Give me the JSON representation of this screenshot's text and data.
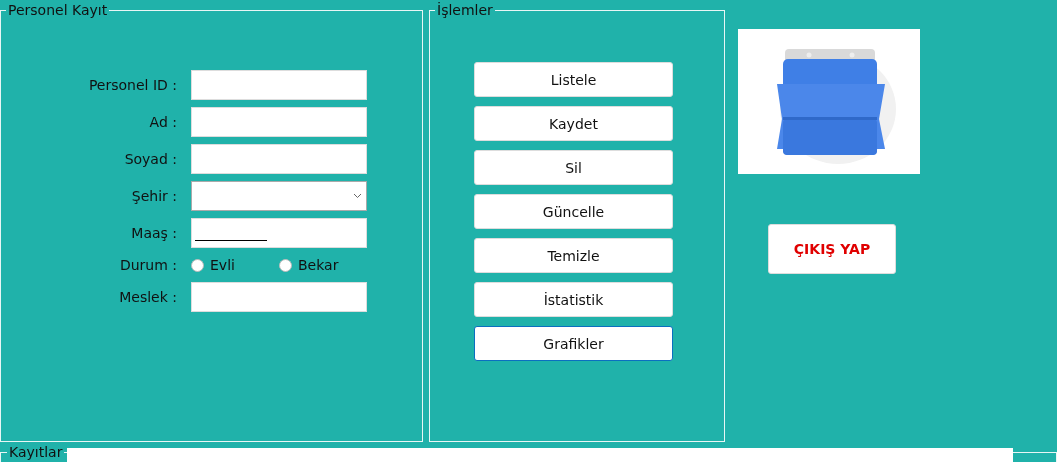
{
  "personnel_group": {
    "title": "Personel Kayıt",
    "fields": [
      {
        "kind": "text",
        "label": "Personel ID :"
      },
      {
        "kind": "text",
        "label": "Ad :"
      },
      {
        "kind": "text",
        "label": "Soyad :"
      },
      {
        "kind": "combo",
        "label": "Şehir :"
      },
      {
        "kind": "masked",
        "label": "Maaş :"
      },
      {
        "kind": "radios",
        "label": "Durum :",
        "options": [
          {
            "label": "Evli",
            "selected": false
          },
          {
            "label": "Bekar",
            "selected": false
          }
        ]
      },
      {
        "kind": "text",
        "label": "Meslek :"
      }
    ]
  },
  "operations_group": {
    "title": "İşlemler",
    "buttons": [
      {
        "label": "Listele",
        "focused": false
      },
      {
        "label": "Kaydet",
        "focused": false
      },
      {
        "label": "Sil",
        "focused": false
      },
      {
        "label": "Güncelle",
        "focused": false
      },
      {
        "label": "Temizle",
        "focused": false
      },
      {
        "label": "İstatistik",
        "focused": false
      },
      {
        "label": "Grafikler",
        "focused": true
      }
    ]
  },
  "exit_button": {
    "label": "ÇIKIŞ YAP"
  },
  "records_group": {
    "title": "Kayıtlar"
  }
}
